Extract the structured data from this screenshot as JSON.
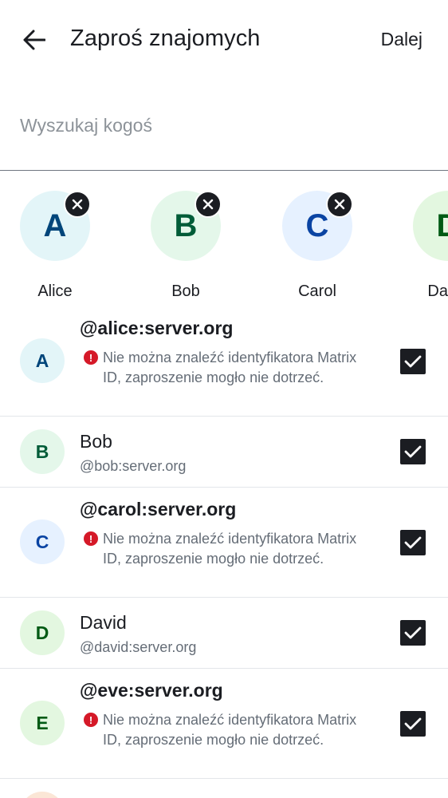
{
  "header": {
    "title": "Zaproś znajomych",
    "next_label": "Dalej"
  },
  "search": {
    "placeholder": "Wyszukaj kogoś",
    "value": ""
  },
  "colors": {
    "text": "#1b1d22",
    "secondary": "#656d77",
    "error": "#d51928",
    "checkbox": "#1b1d22"
  },
  "selected": [
    {
      "initial": "A",
      "name": "Alice",
      "bg": "#e3f5f8",
      "fg": "#00457a"
    },
    {
      "initial": "B",
      "name": "Bob",
      "bg": "#e4f7ea",
      "fg": "#005c38"
    },
    {
      "initial": "C",
      "name": "Carol",
      "bg": "#e6f1ff",
      "fg": "#0a44a3"
    },
    {
      "initial": "D",
      "name": "David",
      "bg": "#e3f7e0",
      "fg": "#005a14"
    }
  ],
  "warning_text": "Nie można znaleźć identyfikatora Matrix ID, zaproszenie mogło nie dotrzeć.",
  "users": [
    {
      "initial": "A",
      "title": "@alice:server.org",
      "subtitle": "",
      "warning": true,
      "checked": true,
      "bg": "#e3f5f8",
      "fg": "#00457a"
    },
    {
      "initial": "B",
      "title": "Bob",
      "subtitle": "@bob:server.org",
      "warning": false,
      "checked": true,
      "bg": "#e4f7ea",
      "fg": "#005c38"
    },
    {
      "initial": "C",
      "title": "@carol:server.org",
      "subtitle": "",
      "warning": true,
      "checked": true,
      "bg": "#e6f1ff",
      "fg": "#0a44a3"
    },
    {
      "initial": "D",
      "title": "David",
      "subtitle": "@david:server.org",
      "warning": false,
      "checked": true,
      "bg": "#e3f7e0",
      "fg": "#005a14"
    },
    {
      "initial": "E",
      "title": "@eve:server.org",
      "subtitle": "",
      "warning": true,
      "checked": true,
      "bg": "#e3f7e0",
      "fg": "#005a14"
    }
  ]
}
